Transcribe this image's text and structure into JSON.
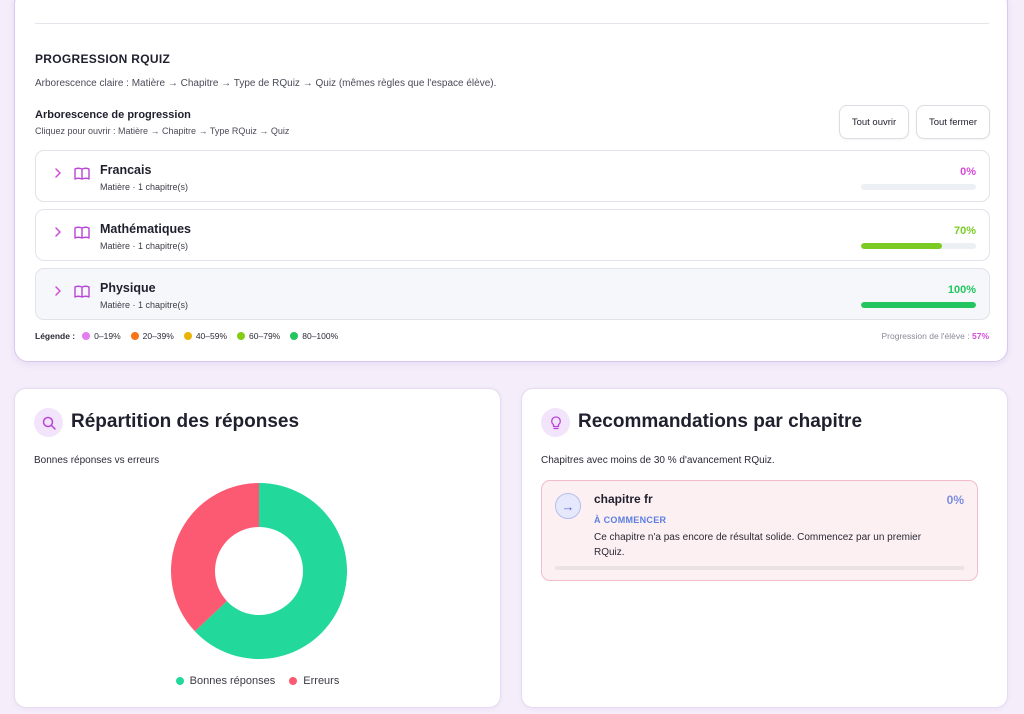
{
  "progression": {
    "title": "PROGRESSION RQUIZ",
    "description": "Arborescence claire : Matière → Chapitre → Type de RQuiz → Quiz (mêmes règles que l'espace élève).",
    "tree_title": "Arborescence de progression",
    "tree_hint": "Cliquez pour ouvrir : Matière → Chapitre → Type RQuiz → Quiz",
    "open_all_label": "Tout ouvrir",
    "close_all_label": "Tout fermer",
    "subjects": [
      {
        "name": "Francais",
        "meta": "Matière · 1 chapitre(s)",
        "percent": "0%",
        "progress": 0,
        "color": "#d44ad8"
      },
      {
        "name": "Mathématiques",
        "meta": "Matière · 1 chapitre(s)",
        "percent": "70%",
        "progress": 0.7,
        "color": "#7ccb25"
      },
      {
        "name": "Physique",
        "meta": "Matière · 1 chapitre(s)",
        "percent": "100%",
        "progress": 1.0,
        "color": "#22c55e"
      }
    ],
    "legend": {
      "label": "Légende :",
      "items": [
        {
          "label": "0–19%",
          "color": "#e47ef0"
        },
        {
          "label": "20–39%",
          "color": "#f97316"
        },
        {
          "label": "40–59%",
          "color": "#eab308"
        },
        {
          "label": "60–79%",
          "color": "#84cc16"
        },
        {
          "label": "80–100%",
          "color": "#22c55e"
        }
      ]
    },
    "student_progress_label": "Progression de l'élève :",
    "student_progress_value": "57%"
  },
  "responses": {
    "title": "Répartition des réponses",
    "subtitle": "Bonnes réponses vs erreurs",
    "icon": "search-icon"
  },
  "chart_data": {
    "type": "pie",
    "categories": [
      "Bonnes réponses",
      "Erreurs"
    ],
    "values": [
      63,
      37
    ],
    "colors": [
      "#22d89a",
      "#fb5a72"
    ],
    "donut": true,
    "legend_position": "bottom"
  },
  "recommendations": {
    "title": "Recommandations par chapitre",
    "subtitle": "Chapitres avec moins de 30 % d'avancement RQuiz.",
    "icon": "lightbulb-icon",
    "items": [
      {
        "name": "chapitre fr",
        "percent": "0%",
        "progress": 0,
        "status": "À COMMENCER",
        "text": "Ce chapitre n'a pas encore de résultat solide. Commencez par un premier RQuiz."
      }
    ]
  }
}
